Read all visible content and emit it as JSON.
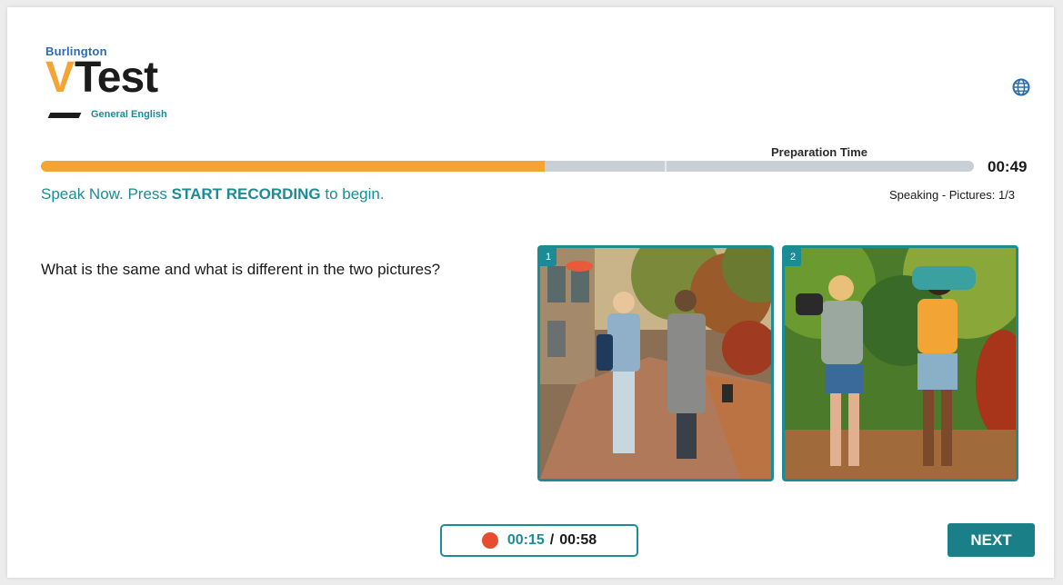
{
  "logo": {
    "top_text": "Burlington",
    "v_letter": "V",
    "main_text": "Test",
    "sub_text": "General English"
  },
  "header": {
    "globe_icon": "globe-icon"
  },
  "progress": {
    "label": "Preparation Time",
    "fraction": 0.54,
    "timer": "00:49"
  },
  "instruction": {
    "prefix": "Speak Now. Press ",
    "emphasis": "START RECORDING",
    "suffix": " to begin."
  },
  "section_label": "Speaking - Pictures: 1/3",
  "question": "What is the same and what is different in the two pictures?",
  "pictures": [
    {
      "number": "1",
      "description_icon": "photo-two-women-walking-city-street"
    },
    {
      "number": "2",
      "description_icon": "photo-two-women-hiking-backpacks"
    }
  ],
  "recording": {
    "elapsed": "00:15",
    "separator": "/",
    "total": "00:58"
  },
  "buttons": {
    "next": "NEXT"
  },
  "colors": {
    "accent_teal": "#1b8c95",
    "accent_orange": "#f2a534",
    "record_red": "#e84c2e"
  }
}
